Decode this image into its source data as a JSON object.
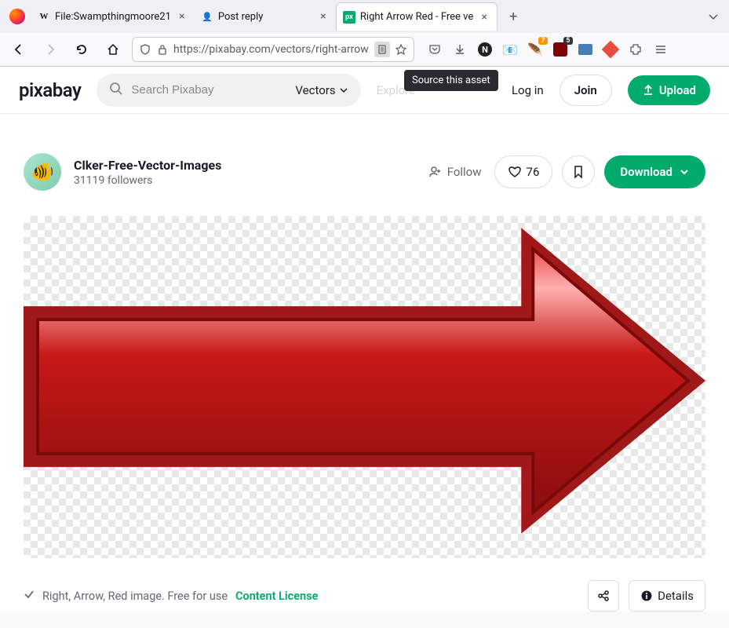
{
  "browser": {
    "tabs": [
      {
        "title": "File:Swampthingmoore21",
        "favicon": "W"
      },
      {
        "title": "Post reply",
        "favicon": "👤"
      },
      {
        "title": "Right Arrow Red - Free ve",
        "favicon": "px",
        "active": true
      }
    ],
    "url": "https://pixabay.com/vectors/right-arrow",
    "tooltip": "Source this asset",
    "ext_badges": {
      "b1": "7",
      "b2": "5"
    }
  },
  "header": {
    "logo": "pixabay",
    "search_placeholder": "Search Pixabay",
    "category": "Vectors",
    "explore": "Explore",
    "login": "Log in",
    "join": "Join",
    "upload": "Upload"
  },
  "author": {
    "name": "Clker-Free-Vector-Images",
    "followers": "31119 followers",
    "follow": "Follow",
    "likes": "76",
    "download": "Download"
  },
  "footer": {
    "caption": "Right, Arrow, Red image. Free for use",
    "license": "Content License",
    "details": "Details"
  }
}
